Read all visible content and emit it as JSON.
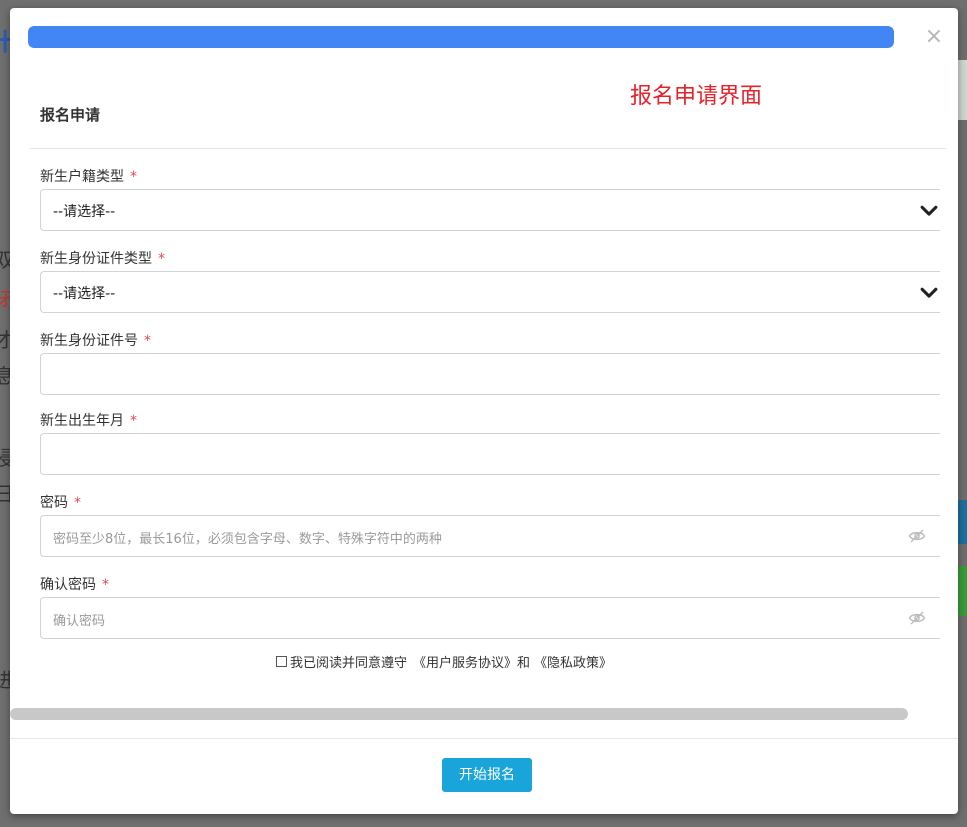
{
  "modal": {
    "progress_percent": 100,
    "close_label": "×",
    "annotation": "报名申请界面",
    "title": "报名申请",
    "required_mark": "*",
    "fields": [
      {
        "label": "新生户籍类型",
        "type": "select",
        "value": "--请选择--"
      },
      {
        "label": "新生身份证件类型",
        "type": "select",
        "value": "--请选择--"
      },
      {
        "label": "新生身份证件号",
        "type": "text",
        "value": ""
      },
      {
        "label": "新生出生年月",
        "type": "text",
        "value": ""
      },
      {
        "label": "密码",
        "type": "password",
        "placeholder": "密码至少8位，最长16位，必须包含字母、数字、特殊字符中的两种"
      },
      {
        "label": "确认密码",
        "type": "password",
        "placeholder": "确认密码"
      }
    ],
    "agreement": {
      "prefix": "我已阅读并同意遵守",
      "terms_link": "《用户服务协议》",
      "and": "和",
      "privacy_link": "《隐私政策》"
    },
    "submit_label": "开始报名"
  },
  "colors": {
    "progress": "#4285f4",
    "annotation": "#e5232a",
    "required": "#e5484d",
    "submit_bg": "#1aa5da"
  }
}
